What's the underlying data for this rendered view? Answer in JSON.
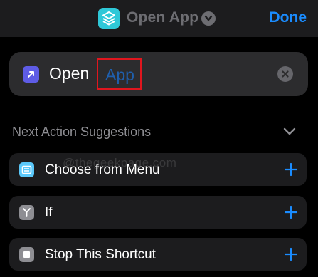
{
  "header": {
    "app_name": "Open App",
    "done_label": "Done",
    "icon": "shortcuts-app-icon"
  },
  "action": {
    "verb": "Open",
    "parameter_placeholder": "App",
    "icon": "open-app-icon"
  },
  "suggestions": {
    "title": "Next Action Suggestions",
    "items": [
      {
        "label": "Choose from Menu",
        "icon": "menu-icon",
        "color": "#5ac8fa"
      },
      {
        "label": "If",
        "icon": "branch-icon",
        "color": "#8e8e93"
      },
      {
        "label": "Stop This Shortcut",
        "icon": "stop-icon",
        "color": "#8e8e93"
      }
    ]
  },
  "watermark": "@thegeekpage.com",
  "colors": {
    "accent": "#1a8cff",
    "highlight_box": "#e0161e",
    "background": "#000000",
    "card": "#2c2c2e"
  }
}
